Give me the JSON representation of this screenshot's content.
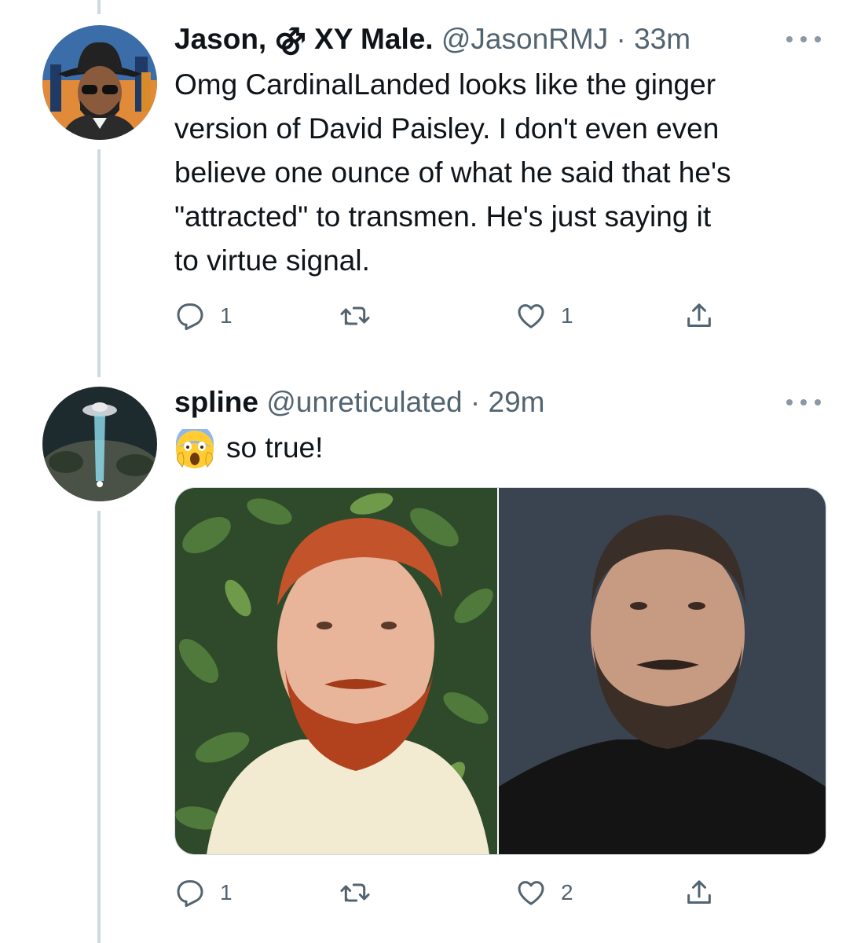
{
  "tweets": [
    {
      "display_name": "Jason, ⚣ XY Male.",
      "handle": "@JasonRMJ",
      "separator": "·",
      "time": "33m",
      "text_lines": [
        "Omg CardinalLanded looks like the ginger",
        "version of David Paisley. I don't even even",
        "believe one ounce of what he said that he's",
        "\"attracted\" to transmen. He's just saying it",
        "to virtue signal."
      ],
      "reply_count": "1",
      "retweet_count": "",
      "like_count": "1"
    },
    {
      "display_name": "spline",
      "handle": "@unreticulated",
      "separator": "·",
      "time": "29m",
      "text": "so true!",
      "emoji": "face-screaming-in-fear",
      "reply_count": "1",
      "retweet_count": "",
      "like_count": "2"
    }
  ],
  "colors": {
    "text": "#0f1419",
    "secondary": "#536471",
    "thread_line": "#cfd9de"
  }
}
